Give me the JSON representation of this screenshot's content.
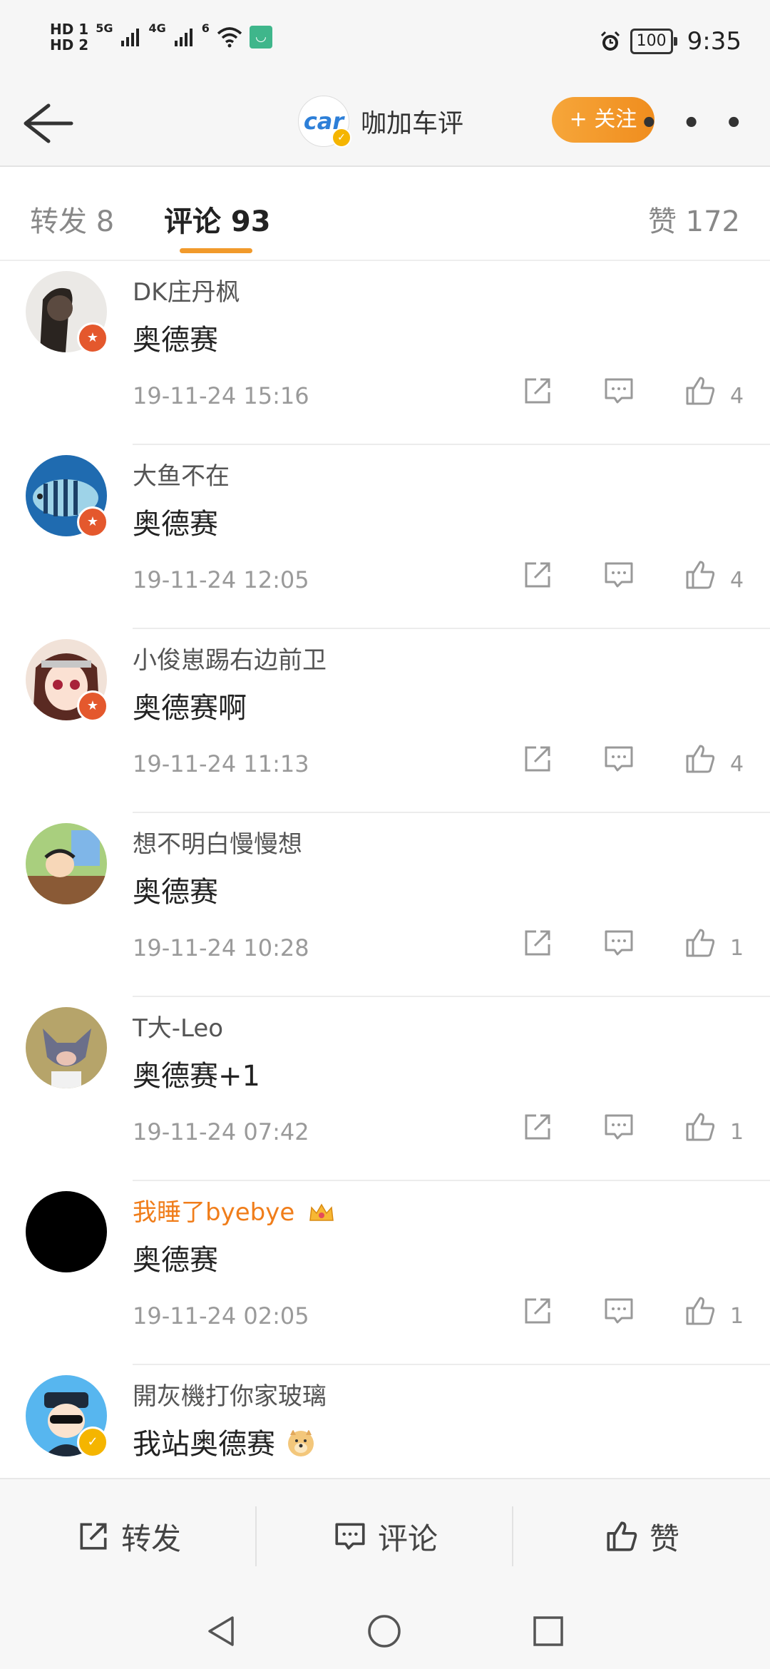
{
  "status_bar": {
    "sim1": "HD 1",
    "sim2": "HD 2",
    "net1": "5G",
    "net2": "4G",
    "wifi": "6",
    "battery": "100",
    "time": "9:35"
  },
  "app_bar": {
    "brand_logo_text": "car",
    "title": "咖加车评",
    "follow_label": "+ 关注",
    "more_label": "• • •"
  },
  "tabs": {
    "repost": "转发 8",
    "comments": "评论 93",
    "likes": "赞 172"
  },
  "comments": [
    {
      "user": "DK庄丹枫",
      "text": "奥德赛",
      "time": "19-11-24 15:16",
      "likes": "4"
    },
    {
      "user": "大鱼不在",
      "text": "奥德赛",
      "time": "19-11-24 12:05",
      "likes": "4"
    },
    {
      "user": "小俊崽踢右边前卫",
      "text": "奥德赛啊",
      "time": "19-11-24 11:13",
      "likes": "4"
    },
    {
      "user": "想不明白慢慢想",
      "text": "奥德赛",
      "time": "19-11-24 10:28",
      "likes": "1"
    },
    {
      "user": "T大-Leo",
      "text": "奥德赛+1",
      "time": "19-11-24 07:42",
      "likes": "1"
    },
    {
      "user": "我睡了byebye",
      "text": "奥德赛",
      "time": "19-11-24 02:05",
      "likes": "1"
    },
    {
      "user": "開灰機打你家玻璃",
      "text": "我站奥德赛",
      "time": "",
      "likes": ""
    }
  ],
  "bottom_bar": {
    "repost": "转发",
    "comment": "评论",
    "like": "赞"
  },
  "colors": {
    "accent_orange": "#f19a2c",
    "vip_name": "#f07d1a",
    "badge_red": "#e4582d",
    "badge_gold": "#f5b500"
  }
}
